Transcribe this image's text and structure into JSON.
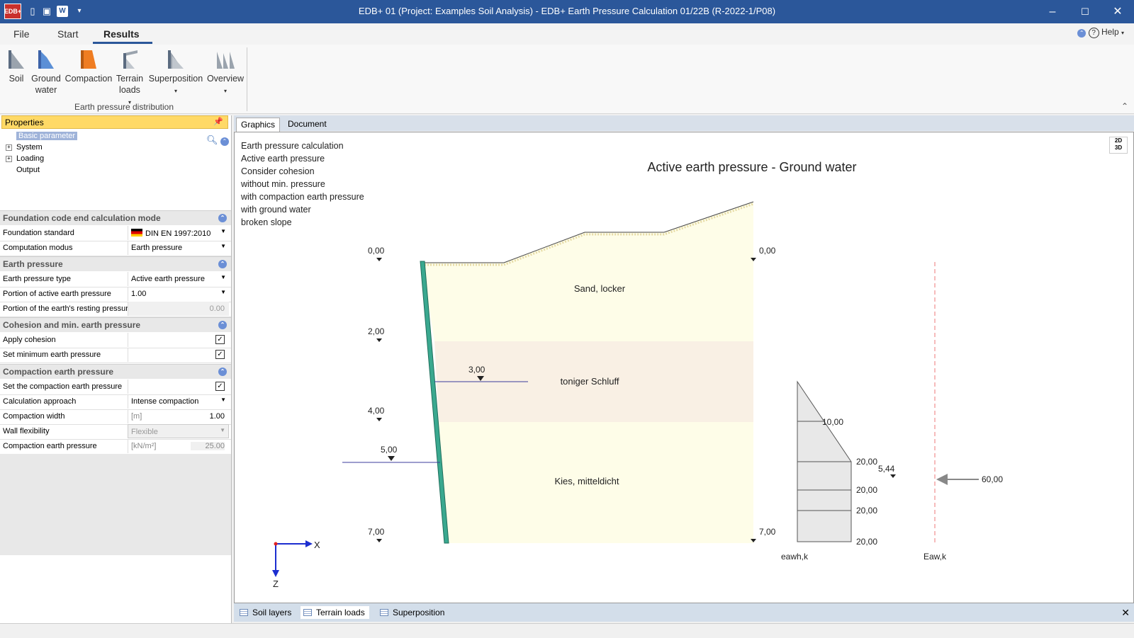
{
  "window": {
    "title": "EDB+ 01 (Project: Examples Soil Analysis) - EDB+ Earth Pressure Calculation 01/22B (R-2022-1/P08)",
    "logo": "EDB+"
  },
  "menu": {
    "tabs": [
      "File",
      "Start",
      "Results"
    ],
    "active": "Results",
    "help_label": "Help"
  },
  "ribbon": {
    "buttons": [
      {
        "label": "Soil"
      },
      {
        "label": "Ground water"
      },
      {
        "label": "Compaction"
      },
      {
        "label": "Terrain loads"
      },
      {
        "label": "Superposition"
      },
      {
        "label": "Overview"
      }
    ],
    "group_label": "Earth pressure distribution"
  },
  "properties": {
    "header": "Properties",
    "tree": [
      "Basic parameter",
      "System",
      "Loading",
      "Output"
    ],
    "sections": {
      "foundation": "Foundation code end calculation mode",
      "earth": "Earth pressure",
      "cohesion": "Cohesion and min. earth pressure",
      "compaction": "Compaction earth pressure"
    },
    "rows": {
      "foundation_standard": {
        "label": "Foundation standard",
        "value": "DIN EN 1997:2010"
      },
      "computation_modus": {
        "label": "Computation modus",
        "value": "Earth pressure"
      },
      "earth_pressure_type": {
        "label": "Earth pressure type",
        "value": "Active earth pressure"
      },
      "portion_active": {
        "label": "Portion of active earth pressure",
        "value": "1.00"
      },
      "portion_resting": {
        "label": "Portion of the earth's resting pressure",
        "value": "0.00"
      },
      "apply_cohesion": {
        "label": "Apply cohesion",
        "checked": true
      },
      "set_min": {
        "label": "Set minimum earth pressure",
        "checked": true
      },
      "set_compaction": {
        "label": "Set the compaction earth pressure",
        "checked": true
      },
      "calc_approach": {
        "label": "Calculation approach",
        "value": "Intense compaction"
      },
      "compaction_width": {
        "label": "Compaction width",
        "unit": "[m]",
        "value": "1.00"
      },
      "wall_flex": {
        "label": "Wall flexibility",
        "value": "Flexible"
      },
      "compaction_pressure": {
        "label": "Compaction earth pressure",
        "unit": "[kN/m²]",
        "value": "25.00"
      }
    }
  },
  "tabs": [
    "Graphics",
    "Document"
  ],
  "graphics": {
    "info_lines": [
      "Earth pressure calculation",
      "Active earth pressure",
      "Consider cohesion",
      "without min. pressure",
      "with compaction earth pressure",
      "with ground water",
      "broken slope"
    ],
    "title": "Active earth pressure - Ground water",
    "view_toggle": [
      "2D",
      "3D"
    ],
    "depth_labels_left": [
      "0,00",
      "2,00",
      "4,00",
      "7,00"
    ],
    "depth_labels_right": [
      "0,00",
      "7,00"
    ],
    "water_labels": [
      "3,00",
      "5,00"
    ],
    "layers": [
      "Sand, locker",
      "toniger Schluff",
      "Kies, mitteldicht"
    ],
    "diagram_values": [
      "10,00",
      "20,00",
      "20,00",
      "20,00",
      "20,00"
    ],
    "resultant_depth": "5,44",
    "resultant_force": "60,00",
    "diagram_label": "eawh,k",
    "resultant_label": "Eaw,k",
    "axis_x": "X",
    "axis_z": "Z"
  },
  "bottom_tabs": [
    "Soil layers",
    "Terrain loads",
    "Superposition"
  ],
  "bottom_active": "Terrain loads"
}
